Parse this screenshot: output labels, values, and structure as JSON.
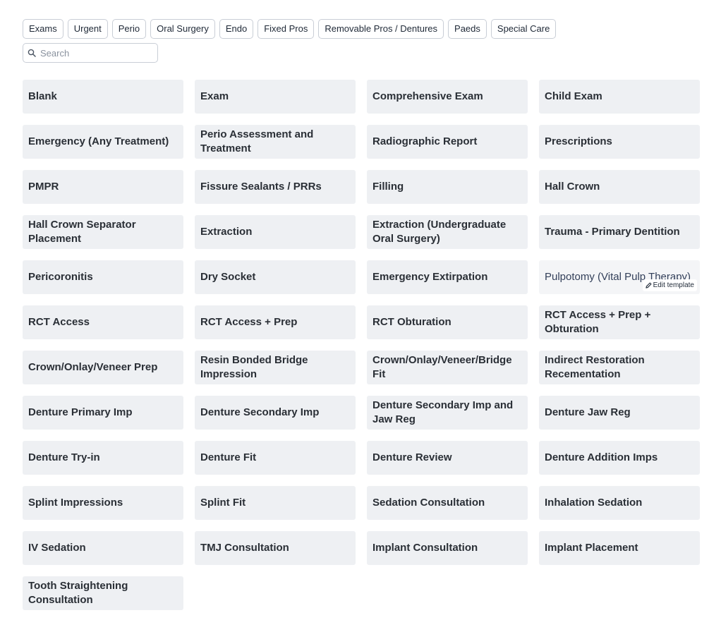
{
  "filters": [
    "Exams",
    "Urgent",
    "Perio",
    "Oral Surgery",
    "Endo",
    "Fixed Pros",
    "Removable Pros / Dentures",
    "Paeds",
    "Special Care"
  ],
  "search": {
    "placeholder": "Search",
    "value": ""
  },
  "templates": [
    "Blank",
    "Exam",
    "Comprehensive Exam",
    "Child Exam",
    "Emergency (Any Treatment)",
    "Perio Assessment and Treatment",
    "Radiographic Report",
    "Prescriptions",
    "PMPR",
    "Fissure Sealants / PRRs",
    "Filling",
    "Hall Crown",
    "Hall Crown Separator Placement",
    "Extraction",
    "Extraction (Undergraduate Oral Surgery)",
    "Trauma - Primary Dentition",
    "Pericoronitis",
    "Dry Socket",
    "Emergency Extirpation",
    "Pulpotomy (Vital Pulp Therapy)",
    "RCT Access",
    "RCT Access + Prep",
    "RCT Obturation",
    "RCT Access + Prep + Obturation",
    "Crown/Onlay/Veneer Prep",
    "Resin Bonded Bridge Impression",
    "Crown/Onlay/Veneer/Bridge Fit",
    "Indirect Restoration Recementation",
    "Denture Primary Imp",
    "Denture Secondary Imp",
    "Denture Secondary Imp and Jaw Reg",
    "Denture Jaw Reg",
    "Denture Try-in",
    "Denture Fit",
    "Denture Review",
    "Denture Addition Imps",
    "Splint Impressions",
    "Splint Fit",
    "Sedation Consultation",
    "Inhalation Sedation",
    "IV Sedation",
    "TMJ Consultation",
    "Implant Consultation",
    "Implant Placement",
    "Tooth Straightening Consultation"
  ],
  "hovered_template": "Pulpotomy (Vital Pulp Therapy)",
  "edit_label": "Edit template",
  "icons": {
    "search": "search-icon",
    "edit": "pencil-icon"
  }
}
